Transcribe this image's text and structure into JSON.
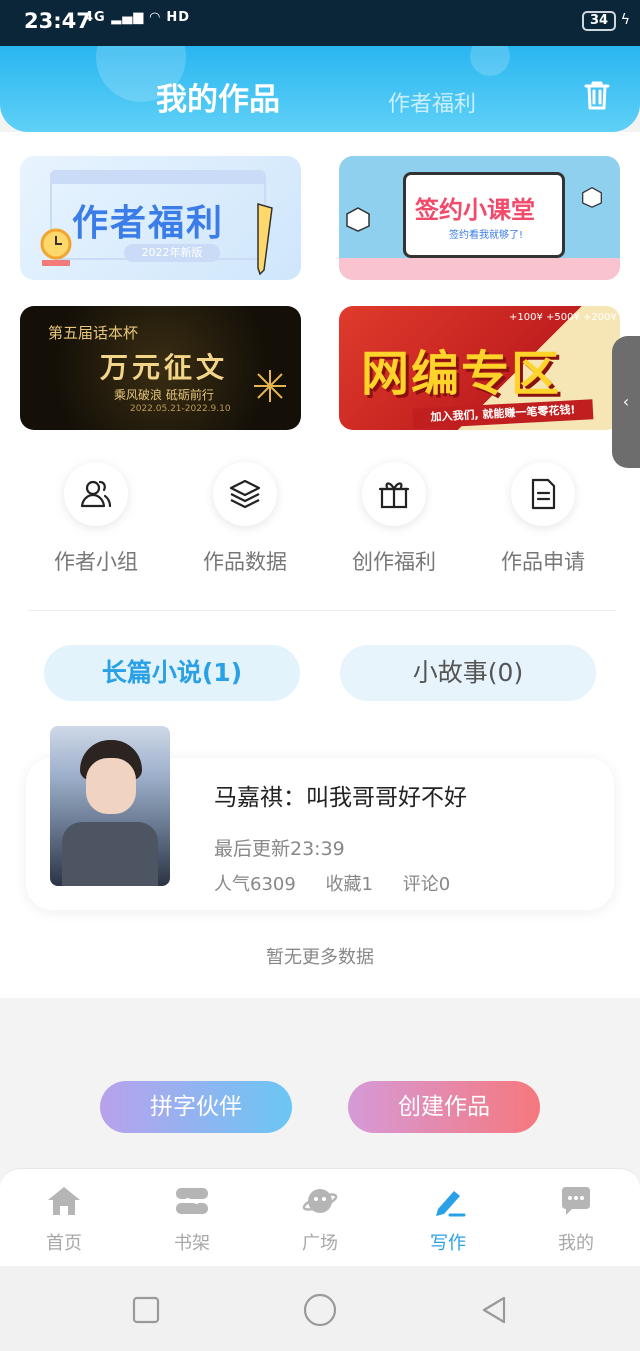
{
  "status_bar": {
    "time": "23:47",
    "network": "4G",
    "hd": "HD",
    "battery": "34"
  },
  "header": {
    "tab_main": "我的作品",
    "tab_sub": "作者福利"
  },
  "banners": {
    "welfare": {
      "title": "作者福利",
      "badge": "2022年新版"
    },
    "class": {
      "title": "签约小课堂",
      "subtitle": "签约看我就够了!"
    },
    "contest": {
      "line1": "第五届话本杯",
      "title": "万元征文",
      "line2": "乘风破浪 砥砺前行",
      "date": "2022.05.21-2022.9.10"
    },
    "editor": {
      "title": "网编专区",
      "strip": "加入我们, 就能赚一笔零花钱!",
      "prize": "+100¥  +500¥  +200¥"
    }
  },
  "entries": [
    {
      "label": "作者小组",
      "icon": "users-icon"
    },
    {
      "label": "作品数据",
      "icon": "layers-icon"
    },
    {
      "label": "创作福利",
      "icon": "gift-icon"
    },
    {
      "label": "作品申请",
      "icon": "document-icon"
    }
  ],
  "categories": {
    "long": "长篇小说(1)",
    "short": "小故事(0)"
  },
  "work": {
    "title": "马嘉祺：叫我哥哥好不好",
    "updated": "最后更新23:39",
    "popularity": "人气6309",
    "favorites": "收藏1",
    "comments": "评论0"
  },
  "no_more": "暂无更多数据",
  "buttons": {
    "partner": "拼字伙伴",
    "create": "创建作品"
  },
  "nav": [
    {
      "label": "首页",
      "icon": "home-icon"
    },
    {
      "label": "书架",
      "icon": "bookshelf-icon"
    },
    {
      "label": "广场",
      "icon": "planet-icon"
    },
    {
      "label": "写作",
      "icon": "pen-icon",
      "active": true
    },
    {
      "label": "我的",
      "icon": "chat-bubble-icon"
    }
  ],
  "colors": {
    "accent": "#2aa0e6",
    "header_start": "#29b6f0",
    "header_end": "#5fd0f7"
  }
}
